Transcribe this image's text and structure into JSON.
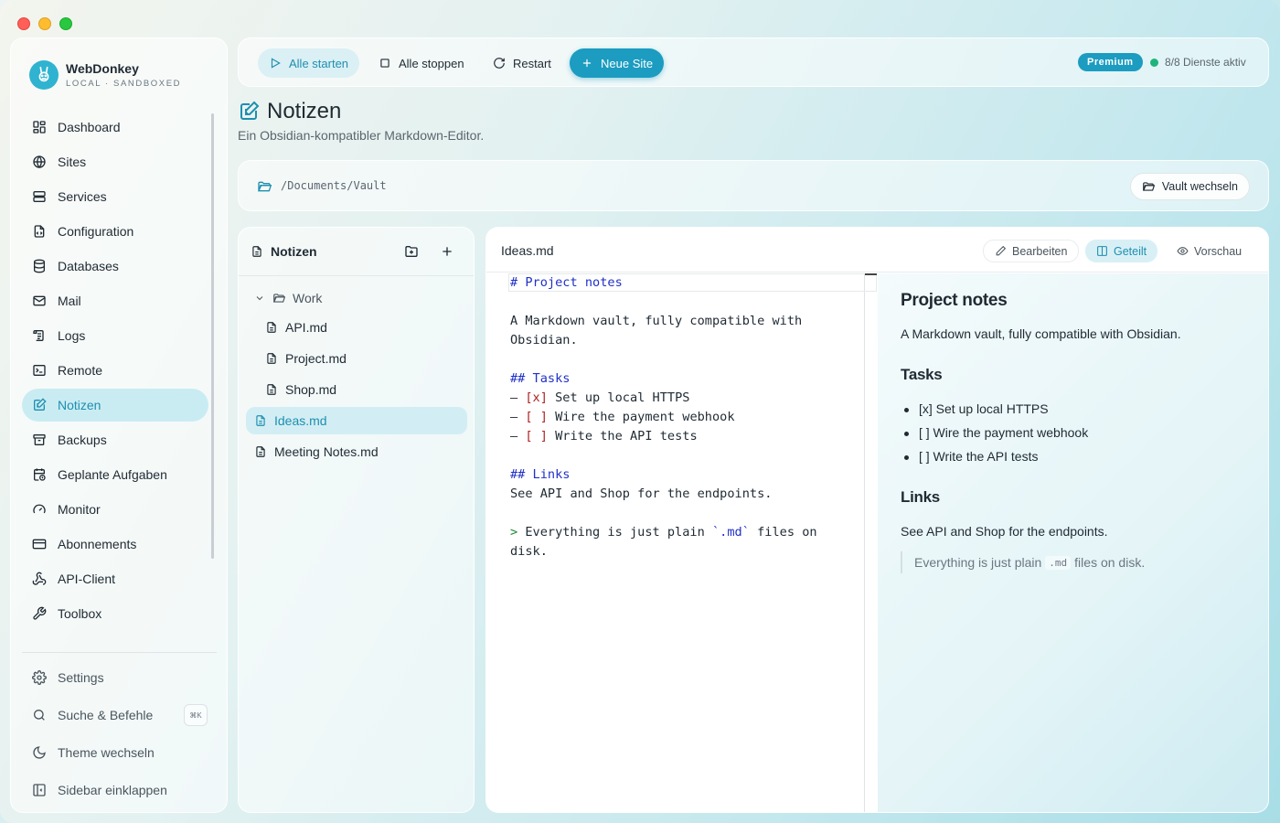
{
  "brand": {
    "name": "WebDonkey",
    "subtitle": "LOCAL · SANDBOXED"
  },
  "sidebar": {
    "items": [
      {
        "label": "Dashboard",
        "icon": "dashboard-icon"
      },
      {
        "label": "Sites",
        "icon": "globe-icon"
      },
      {
        "label": "Services",
        "icon": "server-icon"
      },
      {
        "label": "Configuration",
        "icon": "config-file-icon"
      },
      {
        "label": "Databases",
        "icon": "database-icon"
      },
      {
        "label": "Mail",
        "icon": "mail-icon"
      },
      {
        "label": "Logs",
        "icon": "logs-icon"
      },
      {
        "label": "Remote",
        "icon": "terminal-icon"
      },
      {
        "label": "Notizen",
        "icon": "notes-icon",
        "active": true
      },
      {
        "label": "Backups",
        "icon": "archive-icon"
      },
      {
        "label": "Geplante Aufgaben",
        "icon": "calendar-clock-icon"
      },
      {
        "label": "Monitor",
        "icon": "gauge-icon"
      },
      {
        "label": "Abonnements",
        "icon": "credit-card-icon"
      },
      {
        "label": "API-Client",
        "icon": "webhook-icon"
      },
      {
        "label": "Toolbox",
        "icon": "wrench-icon"
      }
    ],
    "bottom": [
      {
        "label": "Settings",
        "icon": "gear-icon"
      },
      {
        "label": "Suche & Befehle",
        "icon": "search-icon",
        "shortcut": "⌘K"
      },
      {
        "label": "Theme wechseln",
        "icon": "moon-icon"
      },
      {
        "label": "Sidebar einklappen",
        "icon": "sidebar-collapse-icon"
      }
    ]
  },
  "toolbar": {
    "start_all": "Alle starten",
    "stop_all": "Alle stoppen",
    "restart": "Restart",
    "new_site": "Neue Site",
    "premium": "Premium",
    "status": "8/8 Dienste aktiv",
    "status_color": "#1fb57a"
  },
  "page": {
    "title": "Notizen",
    "subtitle": "Ein Obsidian-kompatibler Markdown-Editor."
  },
  "vault": {
    "path": "/Documents/Vault",
    "switch_label": "Vault wechseln"
  },
  "tree": {
    "title": "Notizen",
    "folder": "Work",
    "folder_files": [
      "API.md",
      "Project.md",
      "Shop.md"
    ],
    "root_files": [
      "Ideas.md",
      "Meeting Notes.md"
    ],
    "active_file": "Ideas.md"
  },
  "editor": {
    "filename": "Ideas.md",
    "modes": {
      "edit": "Bearbeiten",
      "split": "Geteilt",
      "preview": "Vorschau"
    },
    "source": {
      "h1": "# Project notes",
      "intro_1": "A Markdown vault, fully compatible with",
      "intro_2": "Obsidian.",
      "h2_tasks": "## Tasks",
      "task_1_mark": "[x]",
      "task_1": "Set up local HTTPS",
      "task_2_mark": "[ ]",
      "task_2": "Wire the payment webhook",
      "task_3_mark": "[ ]",
      "task_3": "Write the API tests",
      "dash": "–",
      "h2_links": "## Links",
      "links_text": "See API and Shop for the endpoints.",
      "quote_mark": ">",
      "quote_1_a": "Everything is just plain",
      "quote_1_code": "`.md`",
      "quote_1_b": "files on",
      "quote_2": "disk."
    },
    "preview": {
      "h1": "Project notes",
      "intro": "A Markdown vault, fully compatible with Obsidian.",
      "h2_tasks": "Tasks",
      "tasks": [
        "[x] Set up local HTTPS",
        "[ ] Wire the payment webhook",
        "[ ] Write the API tests"
      ],
      "h2_links": "Links",
      "links_text": "See API and Shop for the endpoints.",
      "quote_a": "Everything is just plain",
      "quote_code": ".md",
      "quote_b": "files on disk."
    }
  },
  "colors": {
    "accent": "#1b9cc0",
    "active_bg": "#c9ecf3",
    "heading_md": "#2030c8",
    "checkbox_md": "#b02020"
  }
}
